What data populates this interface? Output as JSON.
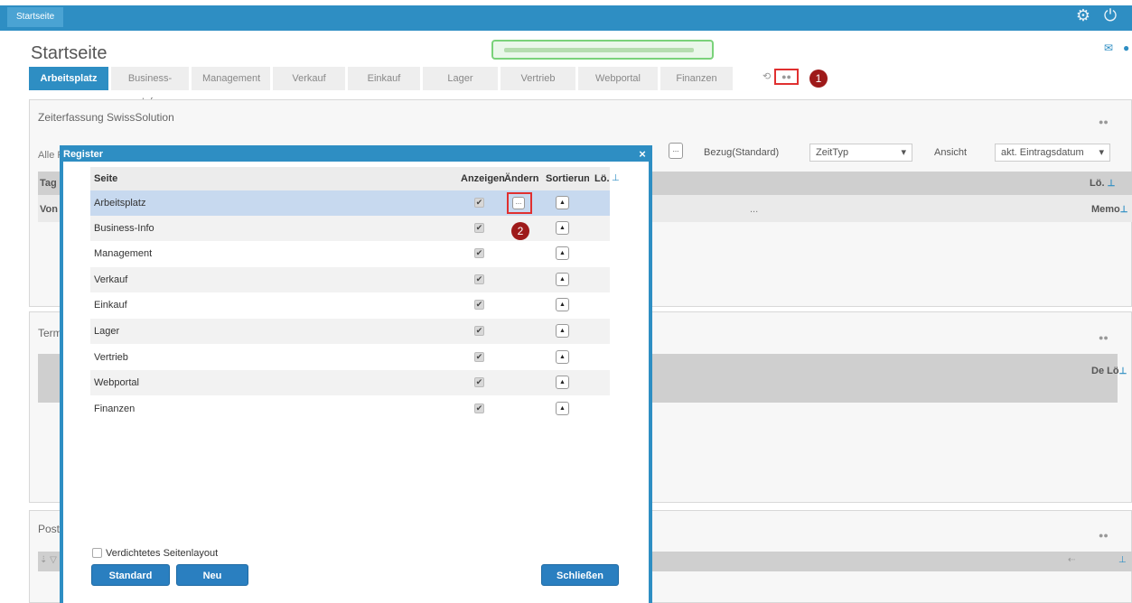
{
  "topbar": {
    "tab_label": "Startseite"
  },
  "page": {
    "title": "Startseite",
    "tabs": [
      "Arbeitsplatz",
      "Business-Info",
      "Management",
      "Verkauf",
      "Einkauf",
      "Lager",
      "Vertrieb",
      "Webportal",
      "Finanzen"
    ],
    "active_tab": "Arbeitsplatz",
    "marker_1": "1"
  },
  "zeit_panel": {
    "title": "Zeiterfassung SwissSolution",
    "alle_label": "Alle F",
    "bezug_label": "Bezug(Standard)",
    "zeittyp_value": "ZeitTyp",
    "ansicht_label": "Ansicht",
    "eintrag_value": "akt. Eintragsdatum",
    "tag_label": "Tag",
    "von_label": "Von",
    "lo_label": "Lö.",
    "memo_label": "Memo",
    "row_ellipsis": "..."
  },
  "termin_panel": {
    "title": "Term",
    "de_label": "De Lö"
  },
  "post_panel": {
    "title": "Post"
  },
  "modal": {
    "title": "Register",
    "close": "×",
    "columns": {
      "seite": "Seite",
      "anzeigen": "Anzeigen",
      "aendern": "Ändern",
      "sortierung": "Sortierung",
      "lo": "Lö."
    },
    "rows": [
      "Arbeitsplatz",
      "Business-Info",
      "Management",
      "Verkauf",
      "Einkauf",
      "Lager",
      "Vertrieb",
      "Webportal",
      "Finanzen"
    ],
    "marker_2": "2",
    "compact_label": "Verdichtetes Seitenlayout",
    "btn_standard": "Standard",
    "btn_neu": "Neu",
    "btn_close": "Schließen"
  }
}
